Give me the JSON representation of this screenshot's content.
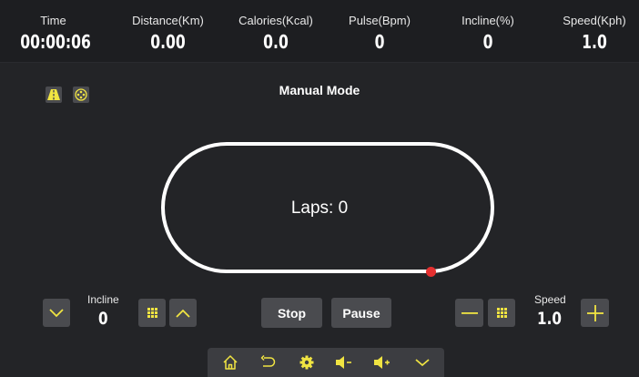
{
  "stats": [
    {
      "label": "Time",
      "value": "00:00:06"
    },
    {
      "label": "Distance(Km)",
      "value": "0.00"
    },
    {
      "label": "Calories(Kcal)",
      "value": "0.0"
    },
    {
      "label": "Pulse(Bpm)",
      "value": "0"
    },
    {
      "label": "Incline(%)",
      "value": "0"
    },
    {
      "label": "Speed(Kph)",
      "value": "1.0"
    }
  ],
  "mode": {
    "title": "Manual Mode"
  },
  "track": {
    "laps_label": "Laps: ",
    "laps_value": "0"
  },
  "incline": {
    "label": "Incline",
    "value": "0"
  },
  "speed": {
    "label": "Speed",
    "value": "1.0"
  },
  "buttons": {
    "stop": "Stop",
    "pause": "Pause"
  },
  "colors": {
    "accent": "#f0e442",
    "background": "#232427",
    "button": "#4a4b4f",
    "runner": "#e53030"
  },
  "icons": [
    "road-icon",
    "film-reel-icon",
    "chevron-down-icon",
    "keypad-icon",
    "chevron-up-icon",
    "minus-icon",
    "plus-icon",
    "home-icon",
    "back-icon",
    "gear-icon",
    "volume-down-icon",
    "volume-up-icon"
  ]
}
